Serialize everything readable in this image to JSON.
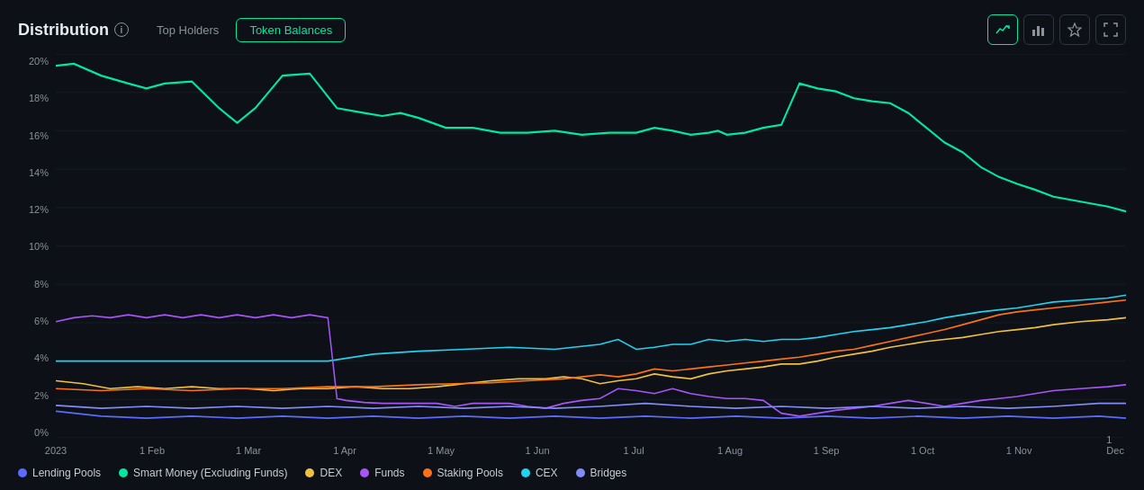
{
  "header": {
    "title": "Distribution",
    "tabs": [
      {
        "label": "Top Holders",
        "active": false
      },
      {
        "label": "Token Balances",
        "active": true
      }
    ],
    "icons": [
      "line-chart-icon",
      "bar-chart-icon",
      "star-icon",
      "fullscreen-icon"
    ]
  },
  "yAxis": {
    "labels": [
      "20%",
      "18%",
      "16%",
      "14%",
      "12%",
      "10%",
      "8%",
      "6%",
      "4%",
      "2%",
      "0%"
    ]
  },
  "xAxis": {
    "labels": [
      "2023",
      "1 Feb",
      "1 Mar",
      "1 Apr",
      "1 May",
      "1 Jun",
      "1 Jul",
      "1 Aug",
      "1 Sep",
      "1 Oct",
      "1 Nov",
      "1 Dec"
    ]
  },
  "legend": [
    {
      "label": "Lending Pools",
      "color": "#5b6bff"
    },
    {
      "label": "Smart Money (Excluding Funds)",
      "color": "#00e8a2"
    },
    {
      "label": "DEX",
      "color": "#f0c040"
    },
    {
      "label": "Funds",
      "color": "#a855f7"
    },
    {
      "label": "Staking Pools",
      "color": "#f97316"
    },
    {
      "label": "CEX",
      "color": "#22d3ee"
    },
    {
      "label": "Bridges",
      "color": "#818cf8"
    }
  ],
  "colors": {
    "accent": "#00e8a2",
    "background": "#0d1117",
    "gridLine": "#1e2530",
    "border": "#30363d"
  }
}
